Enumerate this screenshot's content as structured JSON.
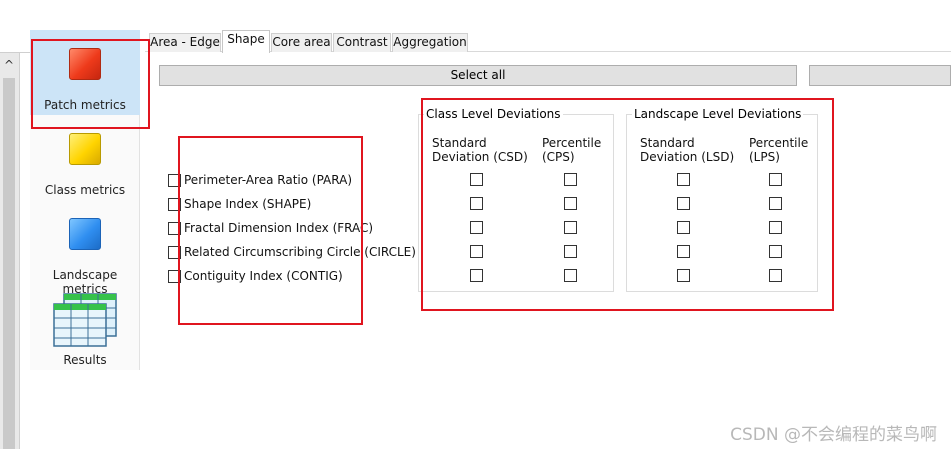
{
  "tabs": [
    "Area - Edge",
    "Shape",
    "Core area",
    "Contrast",
    "Aggregation"
  ],
  "active_tab": "Shape",
  "nav": {
    "patch": "Patch metrics",
    "class": "Class metrics",
    "landscape": "Landscape metrics",
    "results": "Results"
  },
  "select_all": "Select all",
  "scroll_up": "^",
  "metrics": [
    "Perimeter-Area Ratio  (PARA)",
    "Shape Index  (SHAPE)",
    "Fractal Dimension Index  (FRAC)",
    "Related Circumscribing Circle  (CIRCLE)",
    "Contiguity Index  (CONTIG)"
  ],
  "class_group": {
    "title": "Class Level Deviations",
    "col1_line1": "Standard",
    "col1_line2": "Deviation  (CSD)",
    "col2_line1": "Percentile",
    "col2_line2": "(CPS)"
  },
  "landscape_group": {
    "title": "Landscape Level Deviations",
    "col1_line1": "Standard",
    "col1_line2": "Deviation  (LSD)",
    "col2_line1": "Percentile",
    "col2_line2": "(LPS)"
  },
  "watermark": "CSDN @不会编程的菜鸟啊",
  "colors": {
    "annotation_red": "#e0151f",
    "selected_nav": "#cce4f7"
  }
}
